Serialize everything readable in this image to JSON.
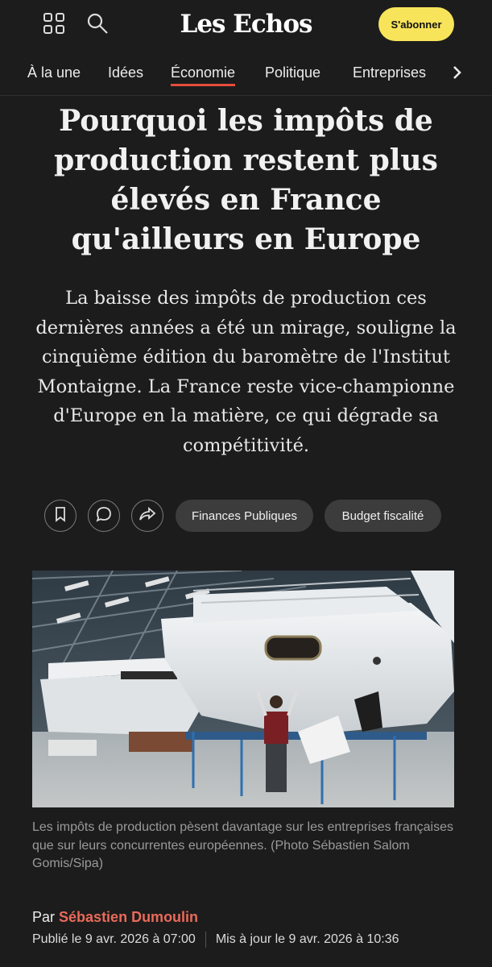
{
  "header": {
    "logo": "Les Echos",
    "subscribe_label": "S'abonner",
    "icons": [
      "grid-icon",
      "search-icon"
    ]
  },
  "nav": {
    "items": [
      {
        "label": "À la une",
        "active": false
      },
      {
        "label": "Idées",
        "active": false
      },
      {
        "label": "Économie",
        "active": true
      },
      {
        "label": "Politique",
        "active": false
      },
      {
        "label": "Entreprises",
        "active": false
      }
    ],
    "more_icon": "chevron-right-icon"
  },
  "article": {
    "title": "Pourquoi les impôts de production restent plus élevés en France qu'ailleurs en Europe",
    "lede": "La baisse des impôts de production ces dernières années a été un mirage, souligne la cinquième édition du baromètre de l'Institut Montaigne. La France reste vice-championne d'Europe en la matière, ce qui dégrade sa compétitivité.",
    "actions": [
      "bookmark-icon",
      "comment-icon",
      "share-icon"
    ],
    "tags": [
      "Finances Publiques",
      "Budget fiscalité"
    ],
    "image_caption": "Les impôts de production pèsent davantage sur les entreprises françaises que sur leurs concurrentes européennes. (Photo Sébastien Salom Gomis/Sipa)",
    "byline_prefix": "Par",
    "author": "Sébastien Dumoulin",
    "published": "Publié le 9 avr. 2026 à 07:00",
    "updated": "Mis à jour le 9 avr. 2026 à 10:36"
  },
  "colors": {
    "background": "#1c1c1c",
    "accent": "#e74c3c",
    "subscribe": "#f7e45a",
    "author": "#ea6a59"
  }
}
